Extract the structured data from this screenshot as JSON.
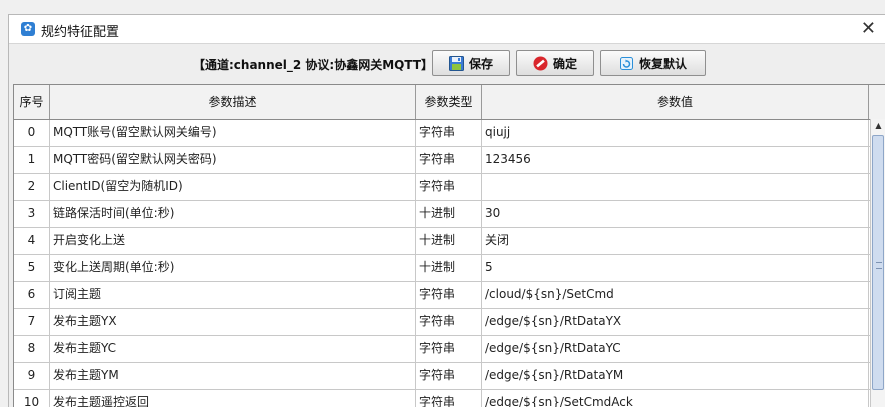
{
  "window": {
    "title": "规约特征配置",
    "close_glyph": "✕"
  },
  "toolbar": {
    "info": "【通道:channel_2  协议:协鑫网关MQTT】",
    "save_label": "保存",
    "confirm_label": "确定",
    "restore_label": "恢复默认"
  },
  "table": {
    "columns": [
      "序号",
      "参数描述",
      "参数类型",
      "参数值"
    ],
    "rows": [
      {
        "idx": "0",
        "desc": "MQTT账号(留空默认网关编号)",
        "type": "字符串",
        "value": "qiujj"
      },
      {
        "idx": "1",
        "desc": "MQTT密码(留空默认网关密码)",
        "type": "字符串",
        "value": "123456"
      },
      {
        "idx": "2",
        "desc": "ClientID(留空为随机ID)",
        "type": "字符串",
        "value": ""
      },
      {
        "idx": "3",
        "desc": "链路保活时间(单位:秒)",
        "type": "十进制",
        "value": "30"
      },
      {
        "idx": "4",
        "desc": "开启变化上送",
        "type": "十进制",
        "value": "关闭"
      },
      {
        "idx": "5",
        "desc": "变化上送周期(单位:秒)",
        "type": "十进制",
        "value": "5"
      },
      {
        "idx": "6",
        "desc": "订阅主题",
        "type": "字符串",
        "value": "/cloud/${sn}/SetCmd"
      },
      {
        "idx": "7",
        "desc": "发布主题YX",
        "type": "字符串",
        "value": "/edge/${sn}/RtDataYX"
      },
      {
        "idx": "8",
        "desc": "发布主题YC",
        "type": "字符串",
        "value": "/edge/${sn}/RtDataYC"
      },
      {
        "idx": "9",
        "desc": "发布主题YM",
        "type": "字符串",
        "value": "/edge/${sn}/RtDataYM"
      },
      {
        "idx": "10",
        "desc": "发布主题遥控返回",
        "type": "字符串",
        "value": "/edge/${sn}/SetCmdAck"
      }
    ]
  },
  "colors": {
    "accent": "#2f7fd3",
    "save_icon": "#3a7bd5",
    "confirm_icon": "#d9262c",
    "restore_icon": "#2a8fd9"
  },
  "icons": {
    "app": "gear-icon",
    "save": "floppy-disk-icon",
    "confirm": "no-entry-icon",
    "restore": "restore-icon"
  }
}
